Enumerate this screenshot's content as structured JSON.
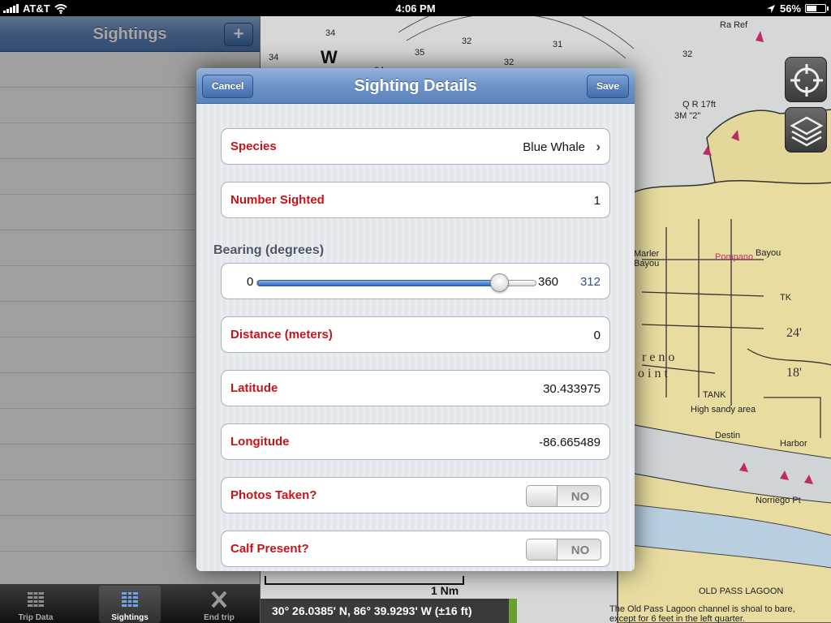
{
  "status_bar": {
    "carrier": "AT&T",
    "time": "4:06 PM",
    "battery": "56%",
    "battery_level": 0.56
  },
  "sidebar": {
    "title": "Sightings",
    "add_label": "+"
  },
  "tabs": [
    {
      "label": "Trip Data",
      "icon": "grid-icon"
    },
    {
      "label": "Sightings",
      "icon": "list-grid-icon",
      "active": true
    },
    {
      "label": "End trip",
      "icon": "x-icon"
    }
  ],
  "map": {
    "coordinates": "30° 26.0385' N, 86° 39.9293' W (±16 ft)",
    "scale": "1 Nm",
    "buttons": [
      "locate-icon",
      "layers-icon"
    ]
  },
  "modal": {
    "title": "Sighting Details",
    "cancel": "Cancel",
    "save": "Save",
    "species_label": "Species",
    "species_value": "Blue Whale",
    "number_label": "Number Sighted",
    "number_value": "1",
    "bearing_header": "Bearing (degrees)",
    "bearing_min": "0",
    "bearing_max": "360",
    "bearing_value": "312",
    "bearing_fraction": 0.8667,
    "distance_label": "Distance (meters)",
    "distance_value": "0",
    "latitude_label": "Latitude",
    "latitude_value": "30.433975",
    "longitude_label": "Longitude",
    "longitude_value": "-86.665489",
    "photos_label": "Photos Taken?",
    "photos_value": "NO",
    "calf_label": "Calf Present?",
    "calf_value": "NO"
  },
  "colors": {
    "field_label": "#c8131a",
    "nav_blue": "#5f86bd",
    "slider_value": "#324f85"
  }
}
